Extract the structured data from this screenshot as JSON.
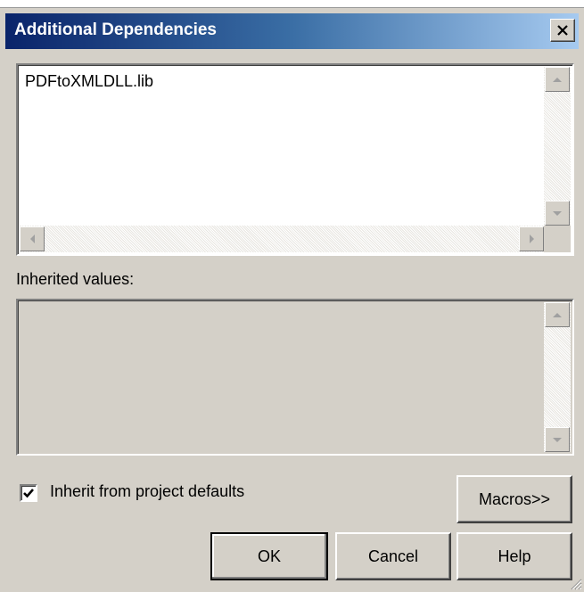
{
  "dialog": {
    "title": "Additional Dependencies",
    "close_label": "×"
  },
  "edit": {
    "value": "PDFtoXMLDLL.lib"
  },
  "inherited": {
    "label": "Inherited values:",
    "value": ""
  },
  "inherit_checkbox": {
    "label": "Inherit from project defaults",
    "checked": true
  },
  "buttons": {
    "macros": "Macros>>",
    "ok": "OK",
    "cancel": "Cancel",
    "help": "Help"
  },
  "colors": {
    "face": "#d4d0c8",
    "title_start": "#0a246a",
    "title_end": "#a6caf0"
  }
}
